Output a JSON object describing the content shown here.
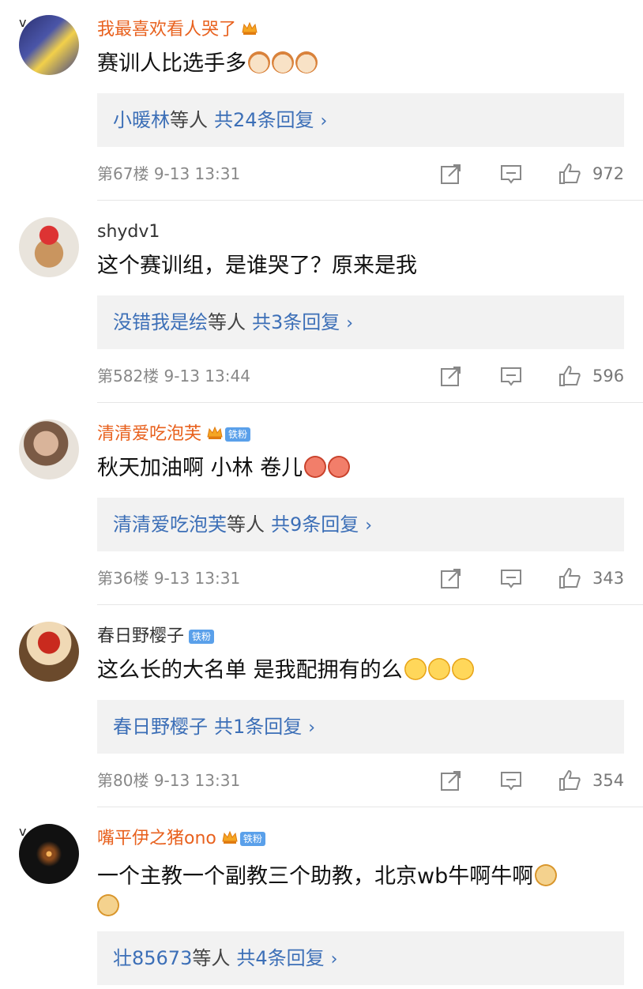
{
  "comments": [
    {
      "user": "我最喜欢看人哭了",
      "text": "赛训人比选手多",
      "reply_names": "小暖林",
      "reply_etc": "等人",
      "reply_count": "共24条回复",
      "floor": "第67楼",
      "time": "9-13 13:31",
      "likes": "972",
      "emoji": [
        "cat-emoji",
        "cat-emoji",
        "cat-emoji"
      ]
    },
    {
      "user": "shydv1",
      "text": "这个赛训组，是谁哭了？原来是我",
      "reply_names": "没错我是绘",
      "reply_etc": "等人",
      "reply_count": "共3条回复",
      "floor": "第582楼",
      "time": "9-13 13:44",
      "likes": "596"
    },
    {
      "user": "清清爱吃泡芙",
      "fans_badge": "铁粉",
      "text": "秋天加油啊 小林 卷儿",
      "reply_names": "清清爱吃泡芙",
      "reply_etc": "等人",
      "reply_count": "共9条回复",
      "floor": "第36楼",
      "time": "9-13 13:31",
      "likes": "343",
      "emoji": [
        "blush-emoji",
        "blush-emoji"
      ]
    },
    {
      "user": "春日野樱子",
      "fans_badge": "铁粉",
      "text": "这么长的大名单 是我配拥有的么",
      "reply_names": "春日野樱子",
      "reply_etc": "",
      "reply_count": "共1条回复",
      "floor": "第80楼",
      "time": "9-13 13:31",
      "likes": "354",
      "emoji": [
        "pleading-emoji",
        "pleading-emoji",
        "pleading-emoji"
      ]
    },
    {
      "user": "嘴平伊之猪ono",
      "fans_badge": "铁粉",
      "text": "一个主教一个副教三个助教，北京wb牛啊牛啊",
      "reply_names": "壮85673",
      "reply_etc": "等人",
      "reply_count": "共4条回复",
      "emoji": [
        "doge-emoji",
        "doge-emoji"
      ]
    }
  ],
  "reply_chevron": "›",
  "colors": {
    "vip_name": "#e8611e",
    "link": "#3c6fb7",
    "reply_bg": "#f2f2f2"
  }
}
